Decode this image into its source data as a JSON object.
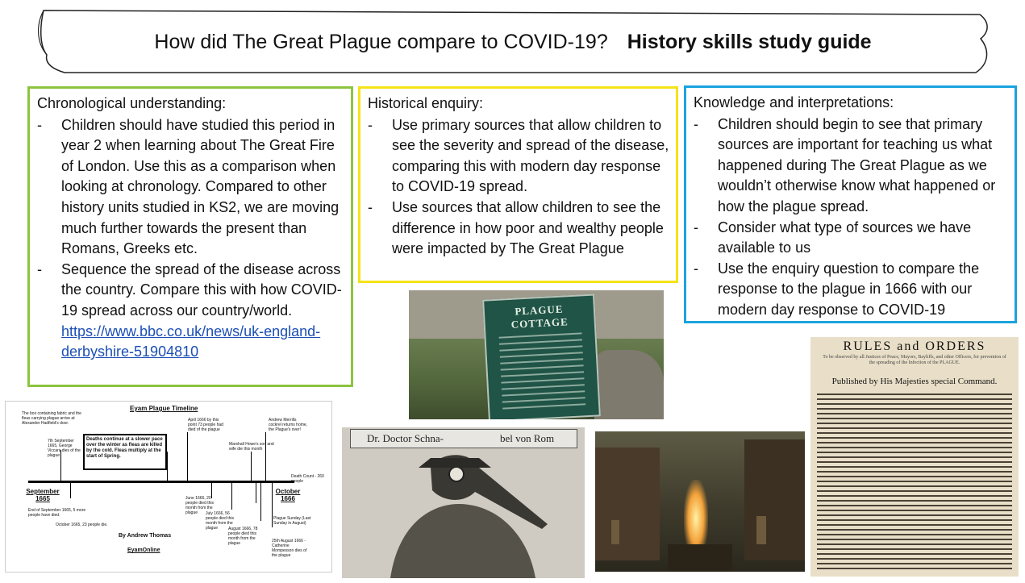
{
  "title": {
    "main": "How did The Great Plague compare to COVID-19?",
    "bold": "History skills study guide"
  },
  "chronology": {
    "heading": "Chronological understanding:",
    "item1": "Children should have studied this period in year 2 when learning about The Great Fire of London. Use this as a comparison when looking at chronology. Compared to other history units studied in KS2, we are moving much further towards the present than Romans, Greeks etc.",
    "item2": "Sequence the spread of the disease across the country. Compare this with how COVID-19 spread across our country/world.",
    "link": "https://www.bbc.co.uk/news/uk-england-derbyshire-51904810"
  },
  "enquiry": {
    "heading": "Historical enquiry:",
    "item1": "Use primary sources that allow children to see the severity and spread of the disease, comparing this with modern day response to COVID-19 spread.",
    "item2": "Use sources that allow children to see the difference in how poor and wealthy people were impacted by The Great Plague"
  },
  "knowledge": {
    "heading": "Knowledge and interpretations:",
    "item1": "Children should begin to see that primary sources are important for teaching us what happened during The Great Plague as we wouldn’t otherwise know what happened or how the plague spread.",
    "item2": "Consider what type of sources we have available to us",
    "item3": "Use the enquiry question to compare the response to the plague in 1666 with our modern day response to COVID-19"
  },
  "images": {
    "cottage_sign": "PLAGUE COTTAGE",
    "doctor_left": "Dr. Doctor Schna-",
    "doctor_right": "bel von Rom",
    "rules_title": "RULES and ORDERS",
    "rules_sub": "To be observed by all Justices of Peace, Mayors, Bayliffs, and other Officers, for prevention of the spreading of the Infection of the PLAGUE.",
    "rules_pub": "Published by His Majesties special Command."
  },
  "timeline": {
    "title": "Eyam Plague Timeline",
    "box_fabric": "The box containing fabric and the fleas carrying plague arrive at Alexander Hadfield's door.",
    "sep7": "7th September 1665, George Viccars dies of the plague",
    "callout": "Deaths continue at a slower pace over the winter as fleas are killed by the cold. Fleas multiply at the start of Spring.",
    "april": "April 1666 by this point 73 people had died of the plague",
    "merrill": "Andrew Merrills cockrel returns home, the Plague's over!",
    "hawe": "Marshall Howe's son and wife die this month",
    "death_count": "Death Count - 260 people",
    "sep_label": "September 1665",
    "oct_label": "October 1666",
    "end_sep": "End of September 1665, 5 more people have died.",
    "oct1665": "October 1665, 23 people die.",
    "june": "June 1666, 20 people died this month from the plague",
    "july": "July 1666, 56 people died this month from the plague",
    "aug": "August 1666, 78 people died this month from the plague",
    "sunday": "Plague Sunday (Last Sunday in August)",
    "aug25": "25th August 1666 - Catherine Mompesson dies of the plague",
    "author": "By Andrew Thomas",
    "site": "EyamOnline"
  },
  "colors": {
    "green": "#8cc43f",
    "yellow": "#f5e318",
    "blue": "#1aa3df",
    "link": "#1b4fb5"
  }
}
